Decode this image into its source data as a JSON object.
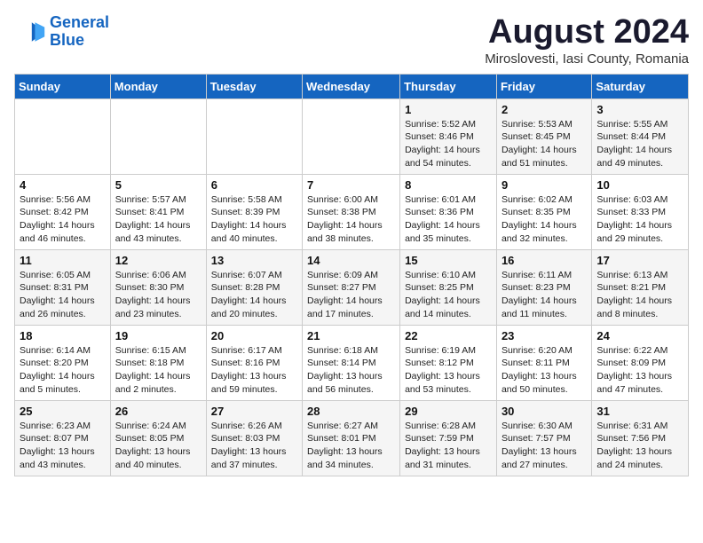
{
  "logo": {
    "line1": "General",
    "line2": "Blue"
  },
  "title": "August 2024",
  "subtitle": "Miroslovesti, Iasi County, Romania",
  "weekdays": [
    "Sunday",
    "Monday",
    "Tuesday",
    "Wednesday",
    "Thursday",
    "Friday",
    "Saturday"
  ],
  "weeks": [
    [
      {
        "day": "",
        "info": ""
      },
      {
        "day": "",
        "info": ""
      },
      {
        "day": "",
        "info": ""
      },
      {
        "day": "",
        "info": ""
      },
      {
        "day": "1",
        "info": "Sunrise: 5:52 AM\nSunset: 8:46 PM\nDaylight: 14 hours\nand 54 minutes."
      },
      {
        "day": "2",
        "info": "Sunrise: 5:53 AM\nSunset: 8:45 PM\nDaylight: 14 hours\nand 51 minutes."
      },
      {
        "day": "3",
        "info": "Sunrise: 5:55 AM\nSunset: 8:44 PM\nDaylight: 14 hours\nand 49 minutes."
      }
    ],
    [
      {
        "day": "4",
        "info": "Sunrise: 5:56 AM\nSunset: 8:42 PM\nDaylight: 14 hours\nand 46 minutes."
      },
      {
        "day": "5",
        "info": "Sunrise: 5:57 AM\nSunset: 8:41 PM\nDaylight: 14 hours\nand 43 minutes."
      },
      {
        "day": "6",
        "info": "Sunrise: 5:58 AM\nSunset: 8:39 PM\nDaylight: 14 hours\nand 40 minutes."
      },
      {
        "day": "7",
        "info": "Sunrise: 6:00 AM\nSunset: 8:38 PM\nDaylight: 14 hours\nand 38 minutes."
      },
      {
        "day": "8",
        "info": "Sunrise: 6:01 AM\nSunset: 8:36 PM\nDaylight: 14 hours\nand 35 minutes."
      },
      {
        "day": "9",
        "info": "Sunrise: 6:02 AM\nSunset: 8:35 PM\nDaylight: 14 hours\nand 32 minutes."
      },
      {
        "day": "10",
        "info": "Sunrise: 6:03 AM\nSunset: 8:33 PM\nDaylight: 14 hours\nand 29 minutes."
      }
    ],
    [
      {
        "day": "11",
        "info": "Sunrise: 6:05 AM\nSunset: 8:31 PM\nDaylight: 14 hours\nand 26 minutes."
      },
      {
        "day": "12",
        "info": "Sunrise: 6:06 AM\nSunset: 8:30 PM\nDaylight: 14 hours\nand 23 minutes."
      },
      {
        "day": "13",
        "info": "Sunrise: 6:07 AM\nSunset: 8:28 PM\nDaylight: 14 hours\nand 20 minutes."
      },
      {
        "day": "14",
        "info": "Sunrise: 6:09 AM\nSunset: 8:27 PM\nDaylight: 14 hours\nand 17 minutes."
      },
      {
        "day": "15",
        "info": "Sunrise: 6:10 AM\nSunset: 8:25 PM\nDaylight: 14 hours\nand 14 minutes."
      },
      {
        "day": "16",
        "info": "Sunrise: 6:11 AM\nSunset: 8:23 PM\nDaylight: 14 hours\nand 11 minutes."
      },
      {
        "day": "17",
        "info": "Sunrise: 6:13 AM\nSunset: 8:21 PM\nDaylight: 14 hours\nand 8 minutes."
      }
    ],
    [
      {
        "day": "18",
        "info": "Sunrise: 6:14 AM\nSunset: 8:20 PM\nDaylight: 14 hours\nand 5 minutes."
      },
      {
        "day": "19",
        "info": "Sunrise: 6:15 AM\nSunset: 8:18 PM\nDaylight: 14 hours\nand 2 minutes."
      },
      {
        "day": "20",
        "info": "Sunrise: 6:17 AM\nSunset: 8:16 PM\nDaylight: 13 hours\nand 59 minutes."
      },
      {
        "day": "21",
        "info": "Sunrise: 6:18 AM\nSunset: 8:14 PM\nDaylight: 13 hours\nand 56 minutes."
      },
      {
        "day": "22",
        "info": "Sunrise: 6:19 AM\nSunset: 8:12 PM\nDaylight: 13 hours\nand 53 minutes."
      },
      {
        "day": "23",
        "info": "Sunrise: 6:20 AM\nSunset: 8:11 PM\nDaylight: 13 hours\nand 50 minutes."
      },
      {
        "day": "24",
        "info": "Sunrise: 6:22 AM\nSunset: 8:09 PM\nDaylight: 13 hours\nand 47 minutes."
      }
    ],
    [
      {
        "day": "25",
        "info": "Sunrise: 6:23 AM\nSunset: 8:07 PM\nDaylight: 13 hours\nand 43 minutes."
      },
      {
        "day": "26",
        "info": "Sunrise: 6:24 AM\nSunset: 8:05 PM\nDaylight: 13 hours\nand 40 minutes."
      },
      {
        "day": "27",
        "info": "Sunrise: 6:26 AM\nSunset: 8:03 PM\nDaylight: 13 hours\nand 37 minutes."
      },
      {
        "day": "28",
        "info": "Sunrise: 6:27 AM\nSunset: 8:01 PM\nDaylight: 13 hours\nand 34 minutes."
      },
      {
        "day": "29",
        "info": "Sunrise: 6:28 AM\nSunset: 7:59 PM\nDaylight: 13 hours\nand 31 minutes."
      },
      {
        "day": "30",
        "info": "Sunrise: 6:30 AM\nSunset: 7:57 PM\nDaylight: 13 hours\nand 27 minutes."
      },
      {
        "day": "31",
        "info": "Sunrise: 6:31 AM\nSunset: 7:56 PM\nDaylight: 13 hours\nand 24 minutes."
      }
    ]
  ]
}
